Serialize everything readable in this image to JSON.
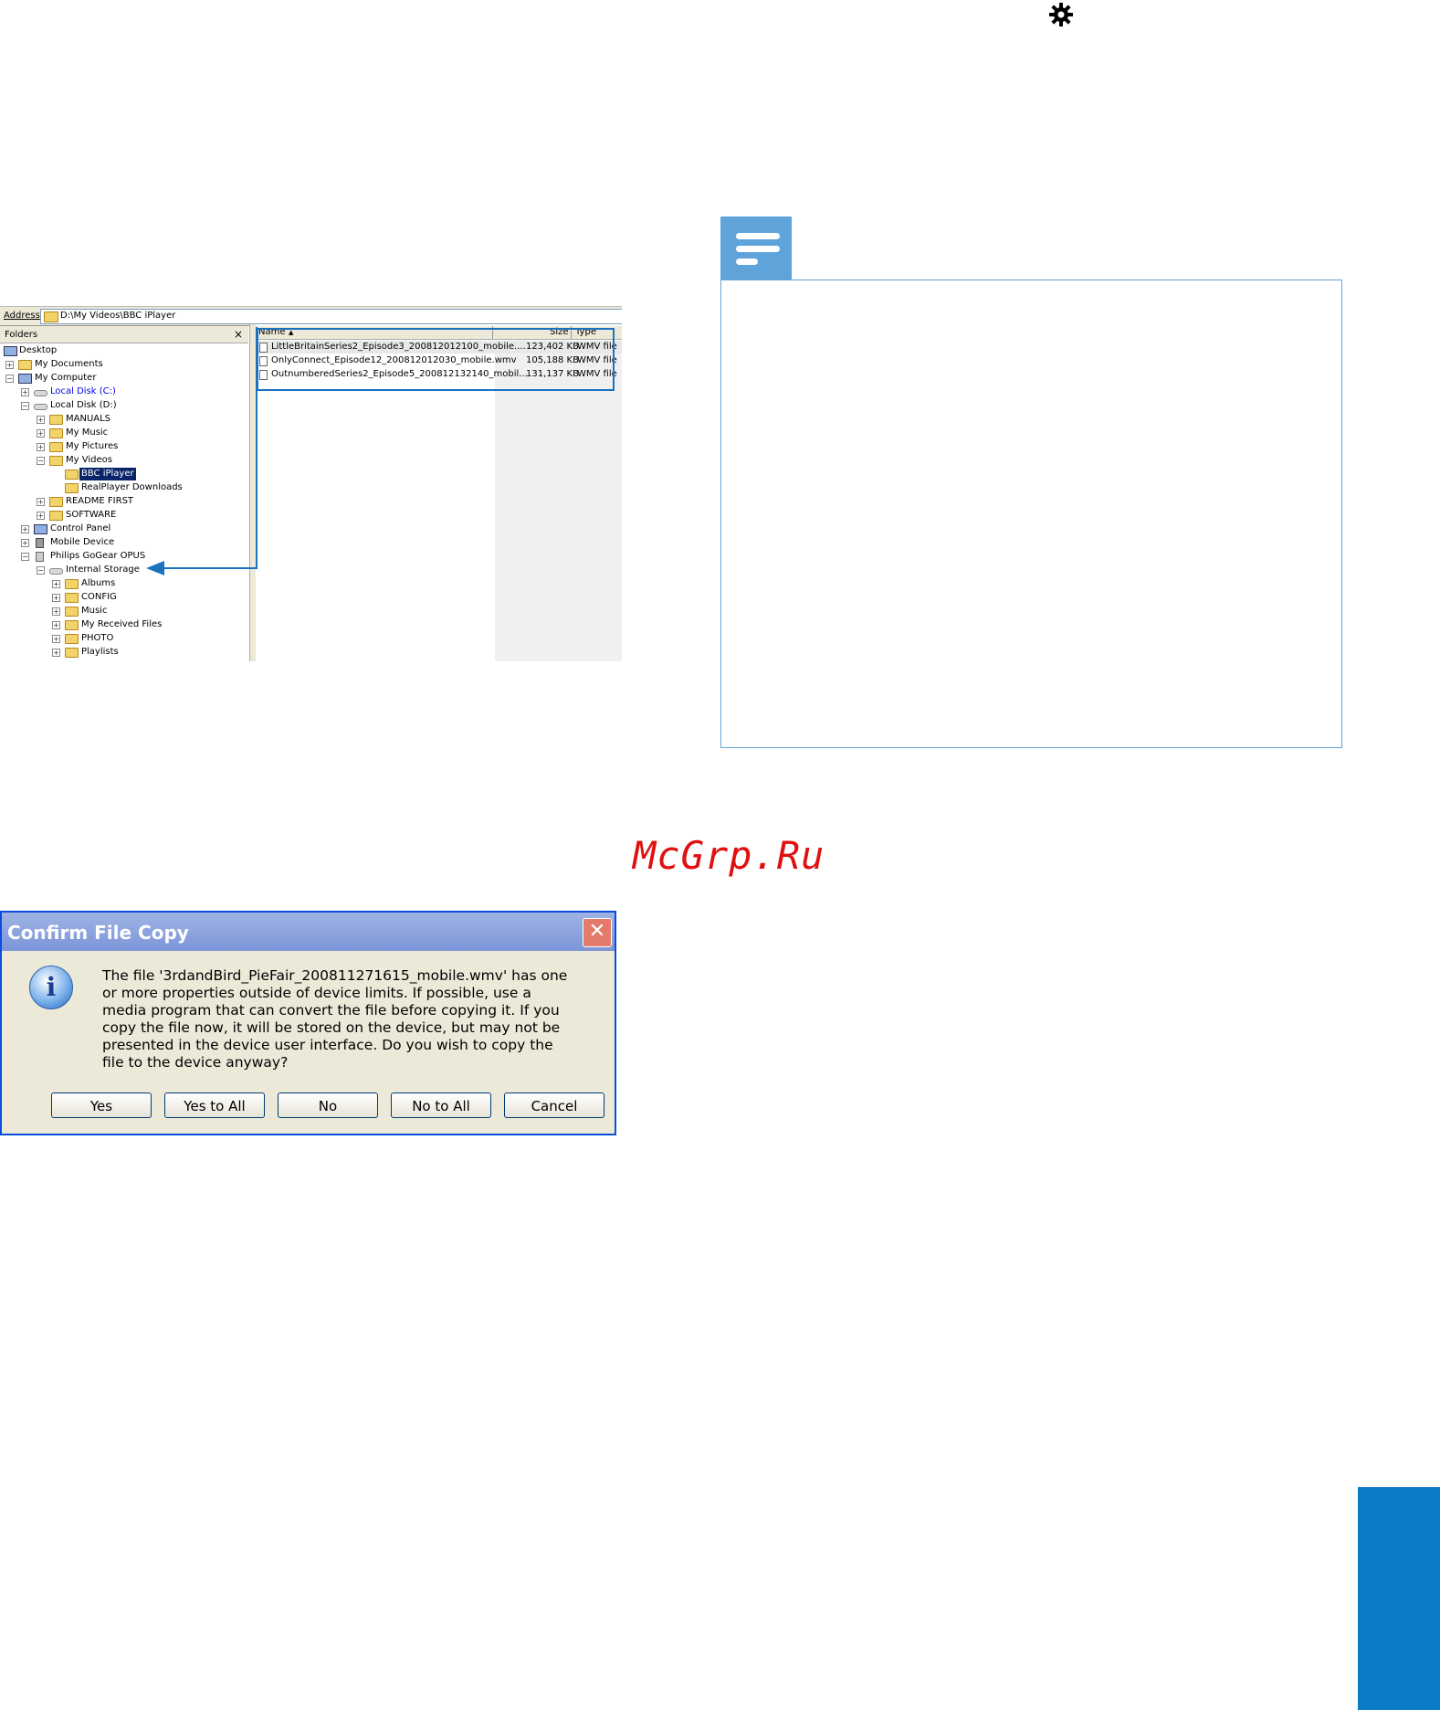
{
  "explorer": {
    "address_label": "Address",
    "address_value": "D:\\My Videos\\BBC iPlayer",
    "folders_header": "Folders",
    "folders_close": "×",
    "tree": [
      {
        "label": "Desktop"
      },
      {
        "label": "My Documents"
      },
      {
        "label": "My Computer"
      },
      {
        "label": "Local Disk (C:)"
      },
      {
        "label": "Local Disk (D:)"
      },
      {
        "label": "MANUALS"
      },
      {
        "label": "My Music"
      },
      {
        "label": "My Pictures"
      },
      {
        "label": "My Videos"
      },
      {
        "label": "BBC iPlayer"
      },
      {
        "label": "RealPlayer Downloads"
      },
      {
        "label": "README FIRST"
      },
      {
        "label": "SOFTWARE"
      },
      {
        "label": "Control Panel"
      },
      {
        "label": "Mobile Device"
      },
      {
        "label": "Philips GoGear OPUS"
      },
      {
        "label": "Internal Storage"
      },
      {
        "label": "Albums"
      },
      {
        "label": "CONFIG"
      },
      {
        "label": "Music"
      },
      {
        "label": "My Received Files"
      },
      {
        "label": "PHOTO"
      },
      {
        "label": "Playlists"
      }
    ],
    "columns": {
      "name": "Name",
      "sort": "▲",
      "size": "Size",
      "type": "Type"
    },
    "files": [
      {
        "name": "LittleBritainSeries2_Episode3_200812012100_mobile....",
        "size": "123,402 KB",
        "type": "WMV file"
      },
      {
        "name": "OnlyConnect_Episode12_200812012030_mobile.wmv",
        "size": "105,188 KB",
        "type": "WMV file"
      },
      {
        "name": "OutnumberedSeries2_Episode5_200812132140_mobil...",
        "size": "131,137 KB",
        "type": "WMV file"
      }
    ]
  },
  "watermark": "McGrp.Ru",
  "dialog": {
    "title": "Confirm File Copy",
    "close": "✕",
    "icon": "i",
    "message": "The file '3rdandBird_PieFair_200811271615_mobile.wmv' has one or more properties outside of device limits. If possible, use a media program that can convert the file before copying it. If you copy the file now, it will be stored on the device, but may not be presented in the device user interface. Do you wish to copy the file to the device anyway?",
    "buttons": {
      "yes": "Yes",
      "yes_all": "Yes to All",
      "no": "No",
      "no_all": "No to All",
      "cancel": "Cancel"
    }
  },
  "colors": {
    "accent": "#1b73c0",
    "note": "#5fa3db",
    "side_tab": "#0b7bc9",
    "watermark": "#e01010"
  }
}
